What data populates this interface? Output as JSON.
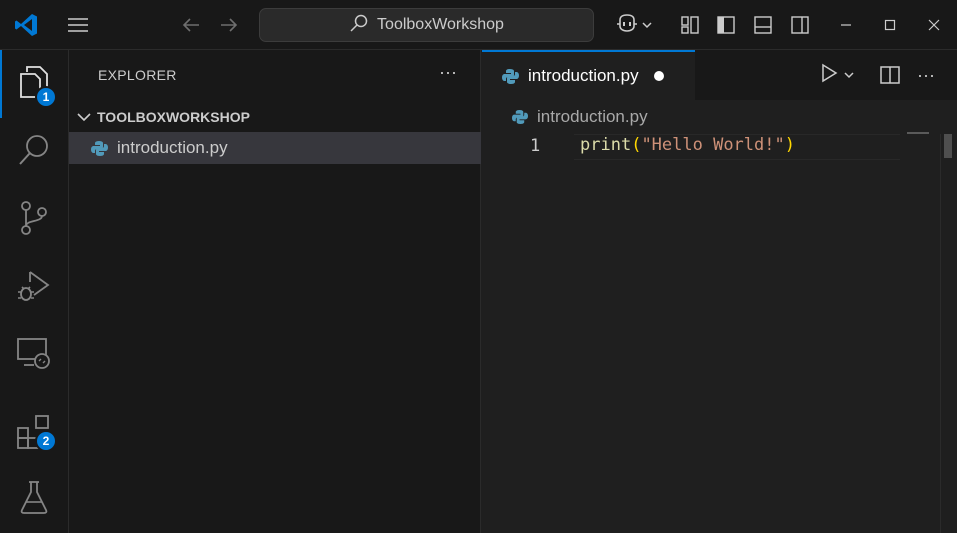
{
  "titlebar": {
    "search_label": "ToolboxWorkshop",
    "icons": [
      "vscode-logo-icon",
      "menu-icon",
      "back-arrow-icon",
      "forward-arrow-icon",
      "search-icon",
      "copilot-icon",
      "chevron-down-icon",
      "customize-layout-icon",
      "toggle-primary-sidebar-icon",
      "toggle-panel-icon",
      "toggle-secondary-sidebar-icon",
      "minimize-icon",
      "maximize-icon",
      "close-icon"
    ]
  },
  "activity_bar": {
    "items": [
      {
        "name": "explorer",
        "badge": "1"
      },
      {
        "name": "search"
      },
      {
        "name": "source-control"
      },
      {
        "name": "run-and-debug"
      },
      {
        "name": "remote-explorer"
      },
      {
        "name": "extensions",
        "badge": "2"
      },
      {
        "name": "testing"
      }
    ]
  },
  "sidebar": {
    "title": "EXPLORER",
    "more_label": "···",
    "folder_name": "TOOLBOXWORKSHOP",
    "files": [
      {
        "name": "introduction.py"
      }
    ]
  },
  "editor": {
    "tab_label": "introduction.py",
    "breadcrumb_label": "introduction.py",
    "line_number": "1",
    "code": {
      "func": "print",
      "open": "(",
      "string": "\"Hello World!\"",
      "close": ")"
    }
  },
  "colors": {
    "accent": "#0078d4",
    "python_icon": "#519aba",
    "string": "#ce9178",
    "function": "#dcdcaa",
    "bracket": "#ffd700"
  }
}
